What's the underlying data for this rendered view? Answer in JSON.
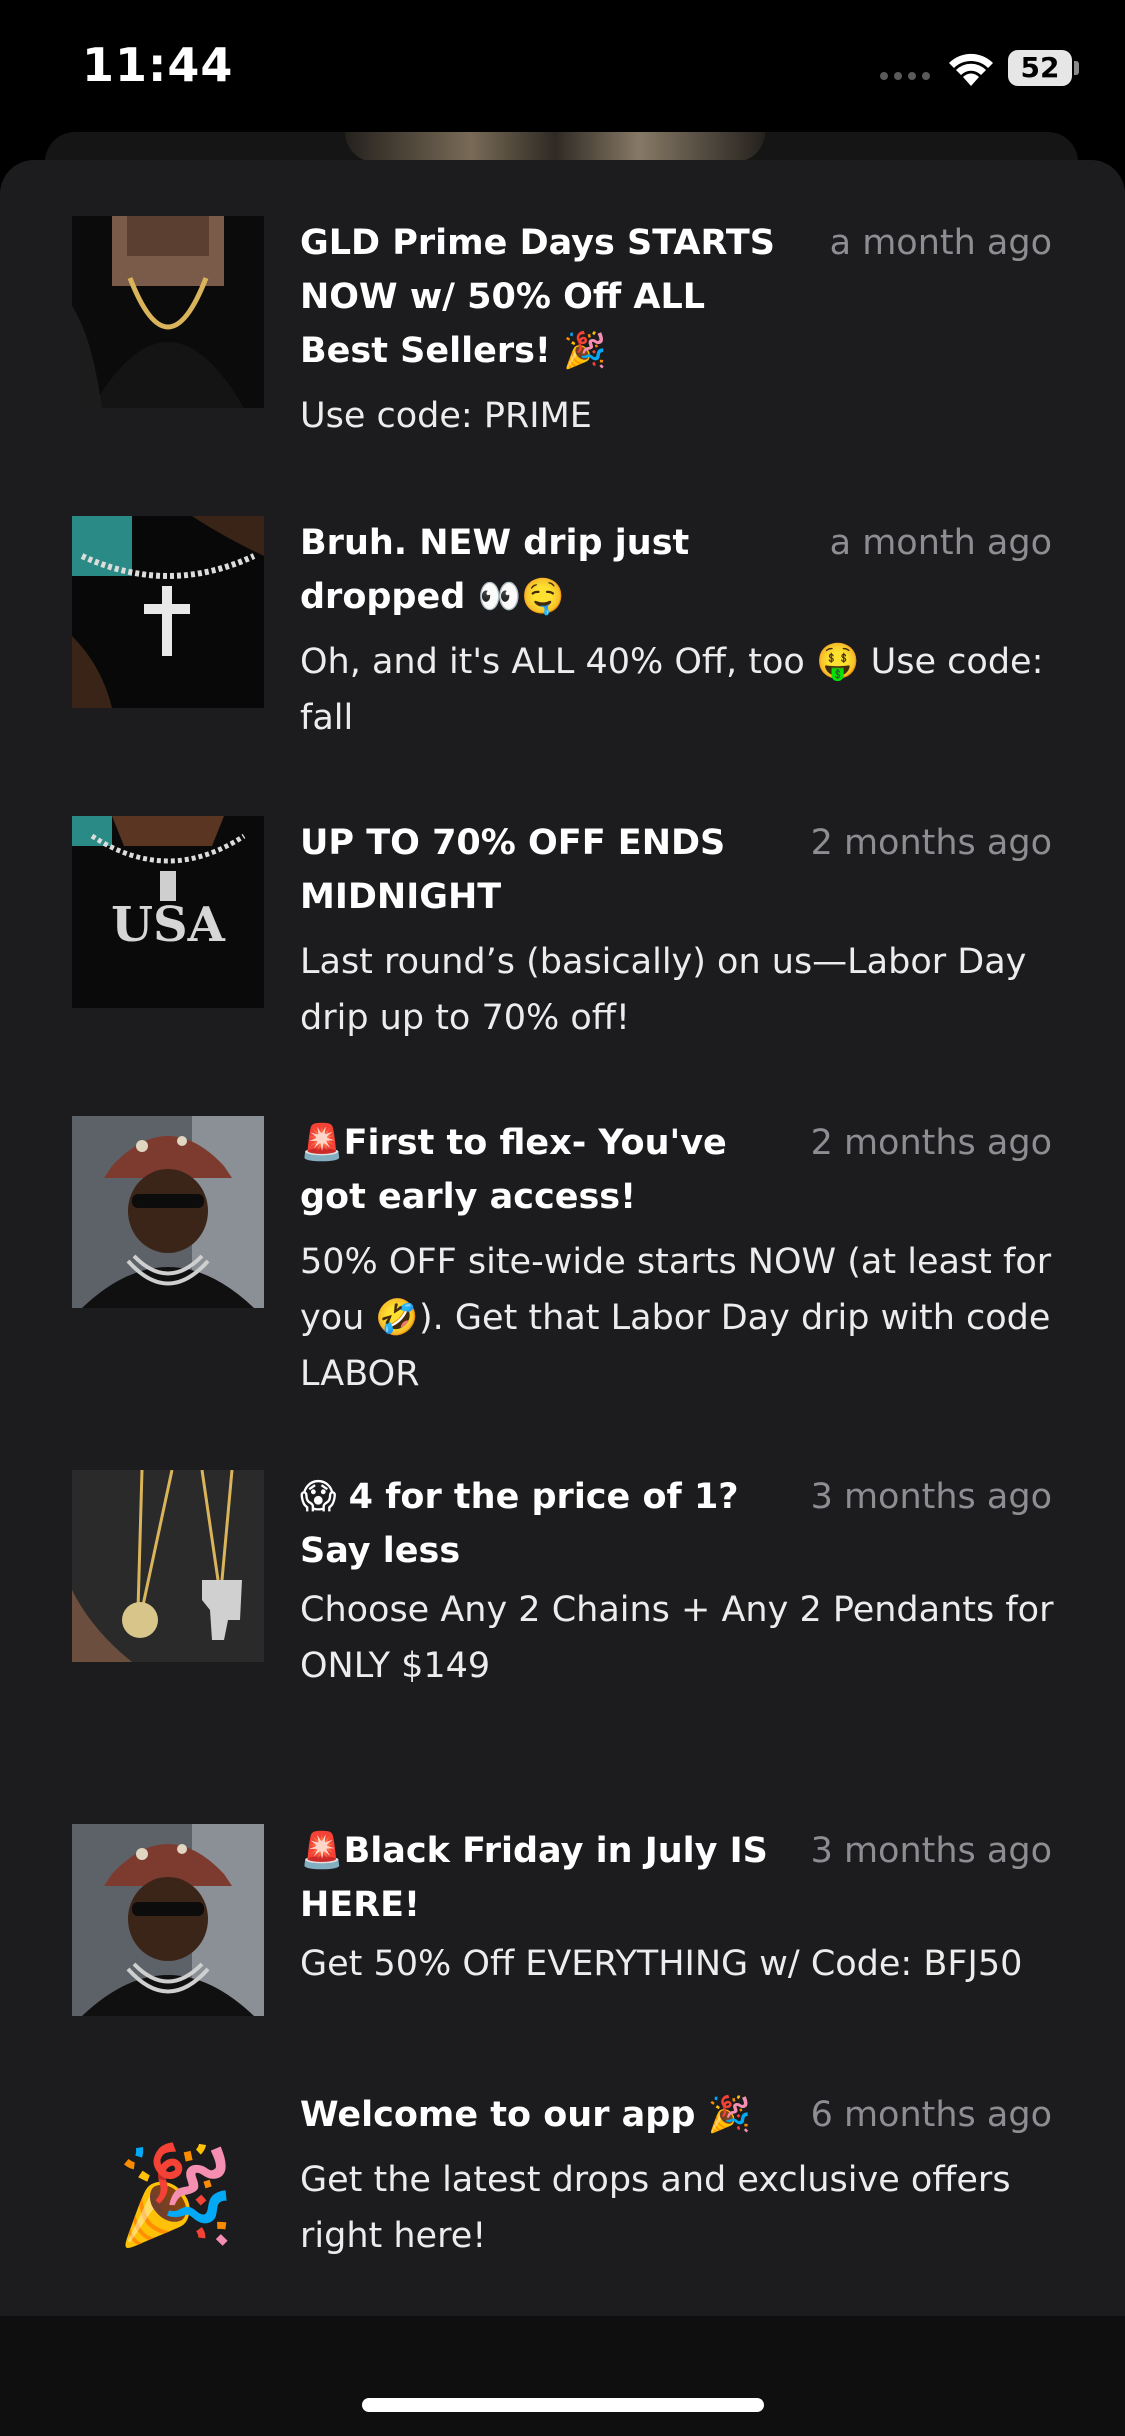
{
  "status_bar": {
    "time": "11:44",
    "battery": "52"
  },
  "notifications": [
    {
      "title": "GLD Prime Days STARTS NOW w/ 50% Off ALL Best Sellers! 🎉",
      "time": "a month ago",
      "body": "Use code: PRIME",
      "thumb_icon": "gold-chain-thumbnail"
    },
    {
      "title": "Bruh. NEW drip just dropped 👀🤤",
      "time": "a month ago",
      "body": "Oh, and it's ALL 40% Off, too 🤑 Use code: fall",
      "thumb_icon": "cross-pendant-thumbnail"
    },
    {
      "title": "UP TO 70% OFF ENDS MIDNIGHT",
      "time": "2 months ago",
      "body": " Last round’s (basically) on us—Labor Day drip up to 70% off!",
      "thumb_icon": "usa-pendant-thumbnail"
    },
    {
      "title": "🚨First to flex- You've got early access!",
      "time": "2 months ago",
      "body": "50% OFF site-wide starts NOW (at least for you 🤣). Get that Labor Day drip with code LABOR",
      "thumb_icon": "model-bucket-hat-thumbnail"
    },
    {
      "title": "😱 4 for the price of 1? Say less",
      "time": "3 months ago",
      "body": "Choose Any 2 Chains + Any 2 Pendants for ONLY $149",
      "thumb_icon": "pendants-thumbnail"
    },
    {
      "title": "🚨Black Friday in July IS HERE!",
      "time": "3 months ago",
      "body": "Get 50% Off EVERYTHING w/ Code: BFJ50",
      "thumb_icon": "model-bucket-hat-thumbnail"
    },
    {
      "title": "Welcome to our app 🎉",
      "time": "6 months ago",
      "body": "Get the latest drops and exclusive offers right here!",
      "thumb_icon": "party-popper-icon",
      "thumb_emoji": "🎉"
    }
  ]
}
